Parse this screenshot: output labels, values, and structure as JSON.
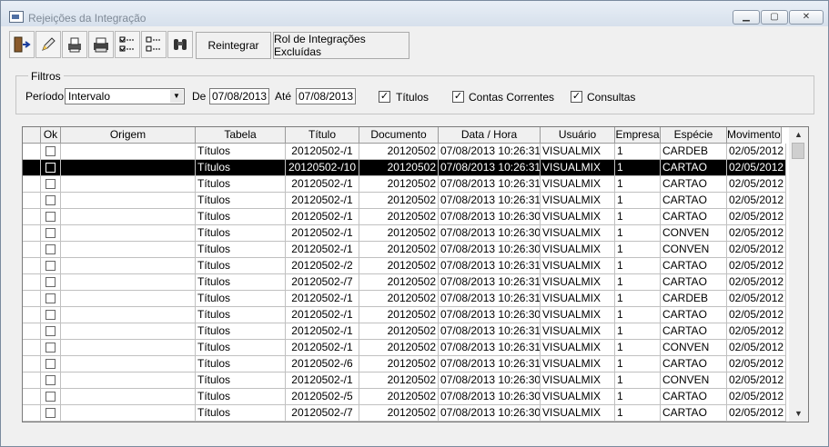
{
  "window": {
    "title": "Rejeições da Integração"
  },
  "toolbar": {
    "icons": [
      "exit-icon",
      "edit-icon",
      "printer-preview-icon",
      "print-icon",
      "check-all-icon",
      "uncheck-all-icon",
      "binoculars-icon"
    ],
    "reintegrar_label": "Reintegrar",
    "rol_label": "Rol de Integrações Excluídas"
  },
  "filters": {
    "legend": "Filtros",
    "periodo_label": "Período",
    "periodo_value": "Intervalo",
    "de_label": "De",
    "de_value": "07/08/2013",
    "ate_label": "Até",
    "ate_value": "07/08/2013",
    "titulos_label": "Títulos",
    "titulos_checked": true,
    "contas_label": "Contas Correntes",
    "contas_checked": true,
    "consultas_label": "Consultas",
    "consultas_checked": true
  },
  "grid": {
    "columns": [
      "Ok",
      "Origem",
      "Tabela",
      "Título",
      "Documento",
      "Data / Hora",
      "Usuário",
      "Empresa",
      "Espécie",
      "Movimento"
    ],
    "selected_row": 1,
    "rows": [
      [
        "",
        "",
        "Títulos",
        "20120502-/1",
        "20120502",
        "07/08/2013 10:26:31",
        "VISUALMIX",
        "1",
        "CARDEB",
        "02/05/2012"
      ],
      [
        "",
        "",
        "Títulos",
        "20120502-/10",
        "20120502",
        "07/08/2013 10:26:31",
        "VISUALMIX",
        "1",
        "CARTAO",
        "02/05/2012"
      ],
      [
        "",
        "",
        "Títulos",
        "20120502-/1",
        "20120502",
        "07/08/2013 10:26:31",
        "VISUALMIX",
        "1",
        "CARTAO",
        "02/05/2012"
      ],
      [
        "",
        "",
        "Títulos",
        "20120502-/1",
        "20120502",
        "07/08/2013 10:26:31",
        "VISUALMIX",
        "1",
        "CARTAO",
        "02/05/2012"
      ],
      [
        "",
        "",
        "Títulos",
        "20120502-/1",
        "20120502",
        "07/08/2013 10:26:30",
        "VISUALMIX",
        "1",
        "CARTAO",
        "02/05/2012"
      ],
      [
        "",
        "",
        "Títulos",
        "20120502-/1",
        "20120502",
        "07/08/2013 10:26:30",
        "VISUALMIX",
        "1",
        "CONVEN",
        "02/05/2012"
      ],
      [
        "",
        "",
        "Títulos",
        "20120502-/1",
        "20120502",
        "07/08/2013 10:26:30",
        "VISUALMIX",
        "1",
        "CONVEN",
        "02/05/2012"
      ],
      [
        "",
        "",
        "Títulos",
        "20120502-/2",
        "20120502",
        "07/08/2013 10:26:31",
        "VISUALMIX",
        "1",
        "CARTAO",
        "02/05/2012"
      ],
      [
        "",
        "",
        "Títulos",
        "20120502-/7",
        "20120502",
        "07/08/2013 10:26:31",
        "VISUALMIX",
        "1",
        "CARTAO",
        "02/05/2012"
      ],
      [
        "",
        "",
        "Títulos",
        "20120502-/1",
        "20120502",
        "07/08/2013 10:26:31",
        "VISUALMIX",
        "1",
        "CARDEB",
        "02/05/2012"
      ],
      [
        "",
        "",
        "Títulos",
        "20120502-/1",
        "20120502",
        "07/08/2013 10:26:30",
        "VISUALMIX",
        "1",
        "CARTAO",
        "02/05/2012"
      ],
      [
        "",
        "",
        "Títulos",
        "20120502-/1",
        "20120502",
        "07/08/2013 10:26:31",
        "VISUALMIX",
        "1",
        "CARTAO",
        "02/05/2012"
      ],
      [
        "",
        "",
        "Títulos",
        "20120502-/1",
        "20120502",
        "07/08/2013 10:26:31",
        "VISUALMIX",
        "1",
        "CONVEN",
        "02/05/2012"
      ],
      [
        "",
        "",
        "Títulos",
        "20120502-/6",
        "20120502",
        "07/08/2013 10:26:31",
        "VISUALMIX",
        "1",
        "CARTAO",
        "02/05/2012"
      ],
      [
        "",
        "",
        "Títulos",
        "20120502-/1",
        "20120502",
        "07/08/2013 10:26:30",
        "VISUALMIX",
        "1",
        "CONVEN",
        "02/05/2012"
      ],
      [
        "",
        "",
        "Títulos",
        "20120502-/5",
        "20120502",
        "07/08/2013 10:26:30",
        "VISUALMIX",
        "1",
        "CARTAO",
        "02/05/2012"
      ],
      [
        "",
        "",
        "Títulos",
        "20120502-/7",
        "20120502",
        "07/08/2013 10:26:30",
        "VISUALMIX",
        "1",
        "CARTAO",
        "02/05/2012"
      ]
    ]
  }
}
